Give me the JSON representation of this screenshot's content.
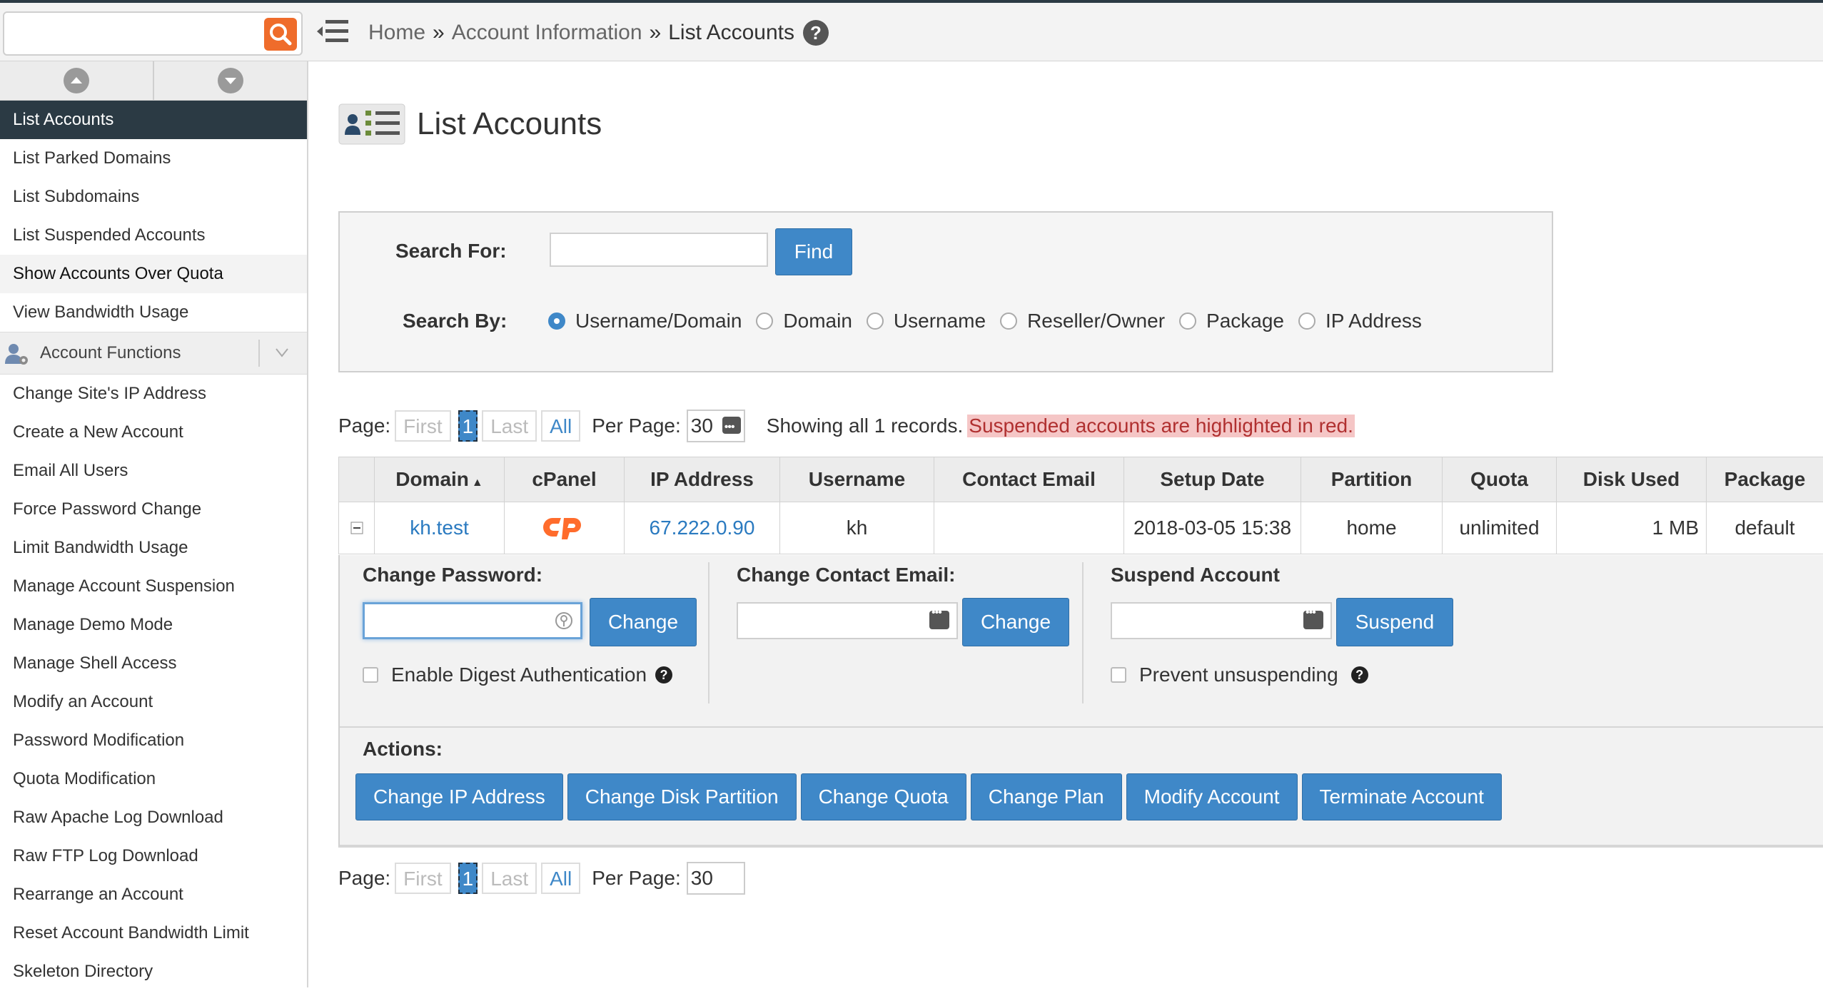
{
  "topbar": {
    "search_placeholder": "",
    "breadcrumb": [
      "Home",
      "Account Information",
      "List Accounts"
    ],
    "breadcrumb_separator": "»",
    "help": "?"
  },
  "sidebar": {
    "items_top": [
      {
        "label": "List Accounts",
        "state": "active"
      },
      {
        "label": "List Parked Domains"
      },
      {
        "label": "List Subdomains"
      },
      {
        "label": "List Suspended Accounts"
      },
      {
        "label": "Show Accounts Over Quota",
        "state": "hover"
      },
      {
        "label": "View Bandwidth Usage"
      }
    ],
    "group_label": "Account Functions",
    "items_group": [
      "Change Site's IP Address",
      "Create a New Account",
      "Email All Users",
      "Force Password Change",
      "Limit Bandwidth Usage",
      "Manage Account Suspension",
      "Manage Demo Mode",
      "Manage Shell Access",
      "Modify an Account",
      "Password Modification",
      "Quota Modification",
      "Raw Apache Log Download",
      "Raw FTP Log Download",
      "Rearrange an Account",
      "Reset Account Bandwidth Limit",
      "Skeleton Directory"
    ]
  },
  "main": {
    "title": "List Accounts",
    "search": {
      "search_for_label": "Search For:",
      "search_value": "",
      "find_label": "Find",
      "search_by_label": "Search By:",
      "options": [
        "Username/Domain",
        "Domain",
        "Username",
        "Reseller/Owner",
        "Package",
        "IP Address"
      ],
      "selected": "Username/Domain"
    },
    "pager": {
      "page_label": "Page:",
      "first": "First",
      "current": "1",
      "last": "Last",
      "all": "All",
      "per_page_label": "Per Page:",
      "per_page_value": "30",
      "showing": "Showing all 1 records.",
      "notice": "Suspended accounts are highlighted in red."
    },
    "table": {
      "headers": [
        "Domain",
        "cPanel",
        "IP Address",
        "Username",
        "Contact Email",
        "Setup Date",
        "Partition",
        "Quota",
        "Disk Used",
        "Package"
      ],
      "sort_indicator": "▲",
      "rows": [
        {
          "domain": "kh.test",
          "ip": "67.222.0.90",
          "username": "kh",
          "contact_email": "",
          "setup_date": "2018-03-05 15:38",
          "partition": "home",
          "quota": "unlimited",
          "disk_used": "1 MB",
          "package": "default"
        }
      ]
    },
    "expand": {
      "change_password_label": "Change Password:",
      "change_btn": "Change",
      "digest_label": "Enable Digest Authentication",
      "contact_label": "Change Contact Email:",
      "contact_btn": "Change",
      "suspend_label": "Suspend Account",
      "suspend_btn": "Suspend",
      "prevent_label": "Prevent unsuspending",
      "actions_label": "Actions:",
      "actions": [
        "Change IP Address",
        "Change Disk Partition",
        "Change Quota",
        "Change Plan",
        "Modify Account",
        "Terminate Account"
      ]
    }
  },
  "colors": {
    "primary": "#3f88c8",
    "sidebar_active": "#2b3a44",
    "search_orange": "#ef6c2b",
    "cpanel_orange": "#ff6c2c",
    "notice_bg": "#f5c6c6"
  }
}
